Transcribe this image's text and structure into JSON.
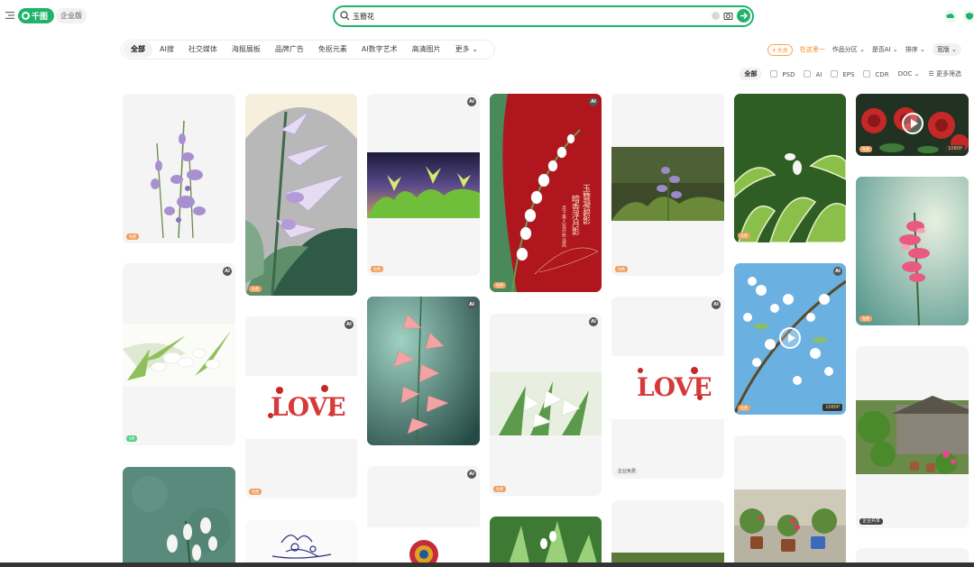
{
  "header": {
    "logo_text": "千图",
    "enterprise_label": "企业版",
    "search_value": "玉簪花",
    "accent": "#1fb36b"
  },
  "categories": [
    "全部",
    "AI搜",
    "社交媒体",
    "海报展板",
    "品牌广告",
    "免抠元素",
    "AI数字艺术",
    "高清图片",
    "更多"
  ],
  "filters": {
    "badge": "十大员",
    "slogan": "在这里一",
    "works_category": "作品分区",
    "is_ai": "是否AI",
    "sort": "排序",
    "layout": "宽版"
  },
  "formats": {
    "all": "全部",
    "items": [
      "PSD",
      "AI",
      "EPS",
      "CDR"
    ],
    "doc": "DOC",
    "more": "更多筛选"
  },
  "cards": {
    "ai_label": "AI",
    "hd_label": "1080P",
    "tag_free": "免费",
    "tag_vip": "VIP",
    "tag_enterprise": "企业免费",
    "tag_enterprise_share": "企业共享",
    "love_text": "LOVE",
    "poem_col1": "玉簪凝碧影",
    "poem_col2": "暗香浮月影",
    "poem_small": "月下美人花开处 清风"
  }
}
